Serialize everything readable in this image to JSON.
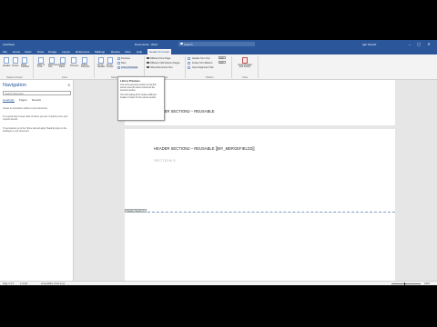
{
  "titlebar": {
    "autosave": "AutoSave",
    "doc_title": "Document1 - Word",
    "search_placeholder": "Search",
    "user": "Igor Stozub",
    "min": "–",
    "max": "▢",
    "close": "✕"
  },
  "tabs": [
    "File",
    "Home",
    "Insert",
    "Draw",
    "Design",
    "Layout",
    "References",
    "Mailings",
    "Review",
    "View",
    "Help",
    "Header & Footer"
  ],
  "ribbon": {
    "b1": [
      "Header",
      "Footer",
      "Page Number"
    ],
    "b2": [
      "Date & Time",
      "Document Info",
      "Quick Parts",
      "Pictures",
      "Online Pictures"
    ],
    "b3": [
      "Go to Header",
      "Go to Footer"
    ],
    "nav_small": [
      "Previous",
      "Next",
      "Link to Previous"
    ],
    "options": [
      "Different First Page",
      "Different Odd & Even Pages",
      "Show Document Text"
    ],
    "position": [
      "Header from Top:",
      "Footer from Bottom:",
      "Insert Alignment Tab"
    ],
    "position_values": [
      "0.5\"",
      "0.5\""
    ],
    "close": "Close Header and Footer",
    "groups": [
      "Header & Footer",
      "Insert",
      "Navigation",
      "Options",
      "Position",
      "Close"
    ]
  },
  "tooltip": {
    "heading": "Link to Previous",
    "paragraphs": [
      "Link to the previous section so that this section uses the same content as the previous section.",
      "Turn this setting off to create a different header or footer for the current section."
    ]
  },
  "nav": {
    "title": "Navigation",
    "close": "✕",
    "search_placeholder": "Search document",
    "tabs": [
      "Headings",
      "Pages",
      "Results"
    ],
    "help": [
      "Create an interactive outline of your document.",
      "It's a great way to keep track of where you are or quickly move your content around.",
      "To get started, go to the Home tab and apply Heading styles to the headings in your document."
    ]
  },
  "document": {
    "footer_text": "FOOTER SECTION2 – REUSABLE",
    "header_text": "HEADER SECTION2 – REUSABLE [[MY_MERGEFIELD2]]",
    "header_tag": "Header -Section 3-",
    "section_label": "SECTION 3"
  },
  "status": {
    "page": "Page 2 of 3",
    "words": "2 words",
    "accessibility": "Accessibility: Good to go",
    "zoom": "100%"
  },
  "colors": {
    "accent": "#2b579a",
    "ribbon_bg": "#f3f3f3",
    "doc_bg": "#e6e6e6"
  }
}
